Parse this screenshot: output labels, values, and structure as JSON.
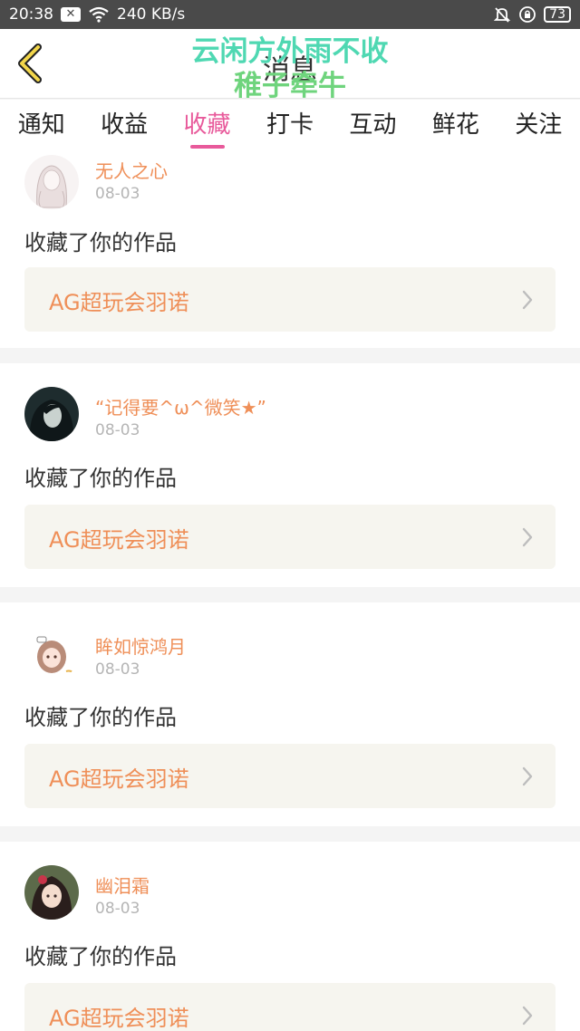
{
  "status_bar": {
    "time": "20:38",
    "notification_icon": "close-box-icon",
    "network_speed": "240 KB/s",
    "battery_level": "73"
  },
  "header": {
    "title": "消息",
    "watermark_line1": "云闲方外雨不收",
    "watermark_line2": "稚子牵牛"
  },
  "tabs": [
    {
      "label": "通知",
      "active": false
    },
    {
      "label": "收益",
      "active": false
    },
    {
      "label": "收藏",
      "active": true
    },
    {
      "label": "打卡",
      "active": false
    },
    {
      "label": "互动",
      "active": false
    },
    {
      "label": "鲜花",
      "active": false
    },
    {
      "label": "关注",
      "active": false
    }
  ],
  "feed": [
    {
      "user": "无人之心",
      "date": "08-03",
      "action": "收藏了你的作品",
      "work": "AG超玩会羽诺"
    },
    {
      "user": "“记得要^ω^微笑★”",
      "date": "08-03",
      "action": "收藏了你的作品",
      "work": "AG超玩会羽诺"
    },
    {
      "user": "眸如惊鸿月",
      "date": "08-03",
      "action": "收藏了你的作品",
      "work": "AG超玩会羽诺"
    },
    {
      "user": "幽泪霜",
      "date": "08-03",
      "action": "收藏了你的作品",
      "work": "AG超玩会羽诺"
    }
  ],
  "colors": {
    "accent_pink": "#e85a9b",
    "username_orange": "#ef8f58",
    "status_bar": "#4a4a4a",
    "work_box_bg": "#f6f5ef"
  }
}
